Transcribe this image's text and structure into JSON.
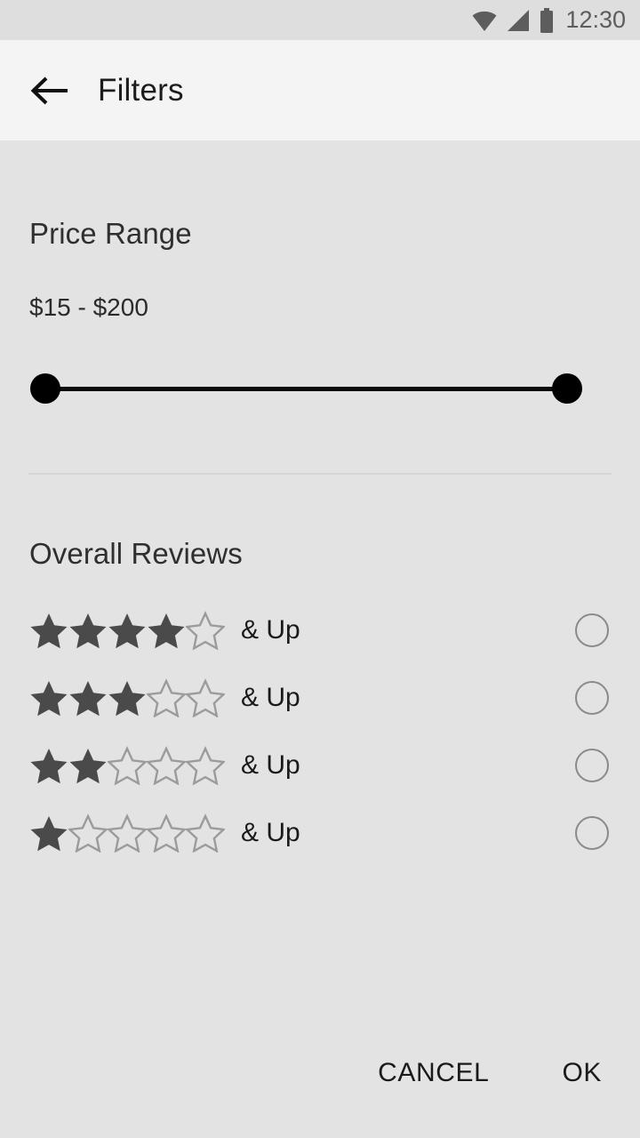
{
  "status_bar": {
    "time": "12:30",
    "icons": [
      "wifi-icon",
      "cellular-signal-icon",
      "battery-icon"
    ],
    "background_color": "#dedede",
    "foreground_color": "#5d5d5d"
  },
  "app_bar": {
    "back_icon": "back-arrow-icon",
    "title": "Filters",
    "background_color": "#f4f4f4",
    "title_color": "#1c1c1c"
  },
  "price_section": {
    "title": "Price Range",
    "value_label": "$15 - $200",
    "min_value": "$15",
    "max_value": "$200",
    "slider": {
      "min_thumb_name": "slider-thumb-min",
      "max_thumb_name": "slider-thumb-max",
      "track_color": "#0a0a0a",
      "thumb_color": "#000000"
    }
  },
  "reviews_section": {
    "title": "Overall Reviews",
    "filled_star_color": "#4a4a4a",
    "empty_star_color": "#9b9b9b",
    "rows": [
      {
        "filled": 4,
        "total": 5,
        "label": "& Up",
        "selected": false
      },
      {
        "filled": 3,
        "total": 5,
        "label": "& Up",
        "selected": false
      },
      {
        "filled": 2,
        "total": 5,
        "label": "& Up",
        "selected": false
      },
      {
        "filled": 1,
        "total": 5,
        "label": "& Up",
        "selected": false
      }
    ]
  },
  "actions": {
    "cancel_label": "CANCEL",
    "ok_label": "OK"
  },
  "theme": {
    "background": "#e3e3e3",
    "divider": "#d5d5d5",
    "radio_outline": "#8a8a8a"
  }
}
